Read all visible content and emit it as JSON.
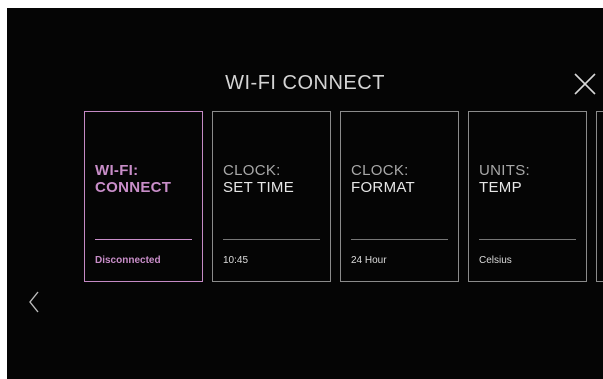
{
  "header": {
    "title": "WI-FI CONNECT",
    "close_icon": "close-icon"
  },
  "cards": [
    {
      "line1": "WI-FI:",
      "line2": "CONNECT",
      "value": "Disconnected",
      "active": true
    },
    {
      "line1": "CLOCK:",
      "line2": "SET TIME",
      "value": "10:45",
      "active": false
    },
    {
      "line1": "CLOCK:",
      "line2": "FORMAT",
      "value": "24 Hour",
      "active": false
    },
    {
      "line1": "UNITS:",
      "line2": "TEMP",
      "value": "Celsius",
      "active": false
    },
    {
      "line1": "",
      "line2": "",
      "value": "",
      "active": false
    }
  ],
  "navigation": {
    "prev_icon": "chevron-left-icon"
  },
  "colors": {
    "background": "#050505",
    "accent": "#c98ec9",
    "border": "#8b8b8b",
    "text": "#e6e6e6"
  }
}
